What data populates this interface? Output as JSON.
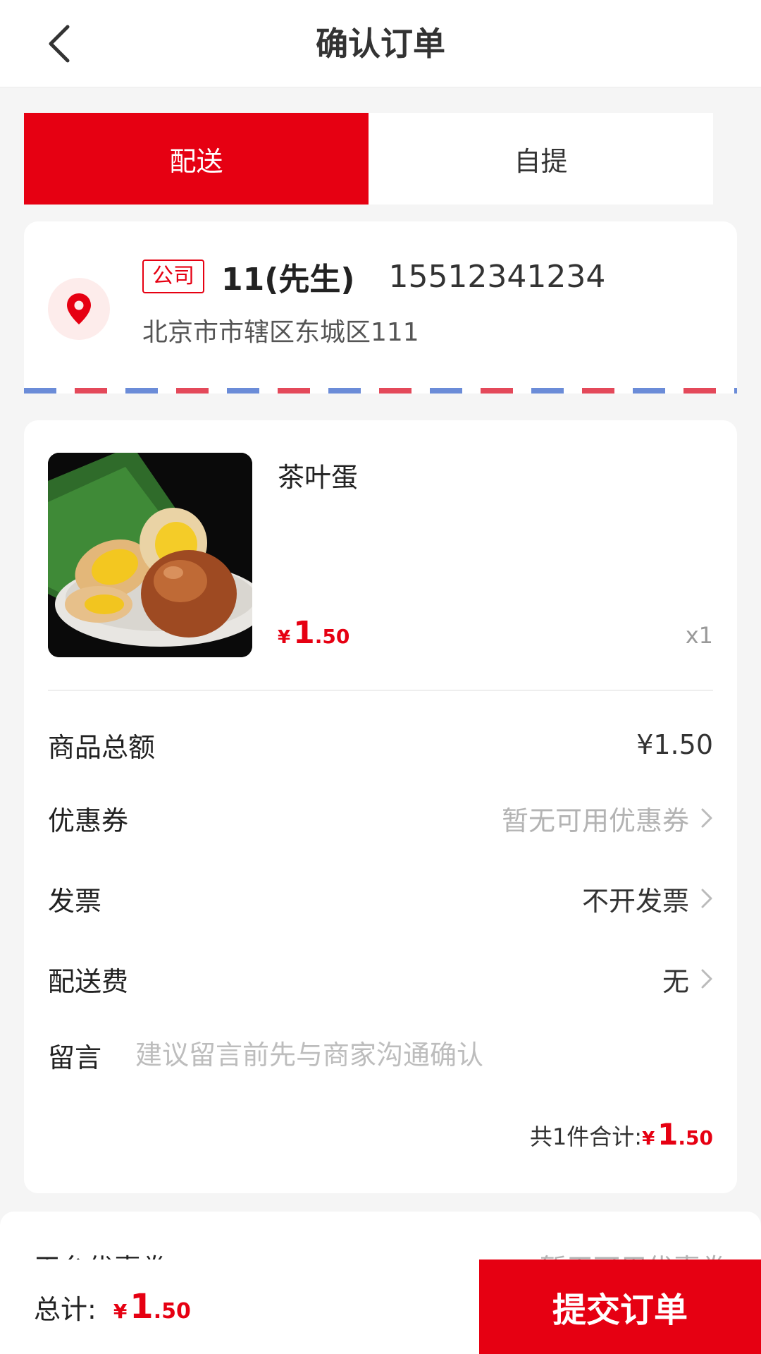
{
  "header": {
    "title": "确认订单",
    "back_icon": "chevron-left-icon"
  },
  "delivery_tabs": [
    {
      "label": "配送",
      "active": true
    },
    {
      "label": "自提",
      "active": false
    }
  ],
  "address": {
    "tag": "公司",
    "name": "11(先生)",
    "phone": "15512341234",
    "detail": "北京市市辖区东城区111",
    "icon": "location-pin-icon"
  },
  "product": {
    "name": "茶叶蛋",
    "price_symbol": "¥",
    "price_int": "1",
    "price_dec": ".50",
    "quantity": "x1",
    "image": "tea-egg-photo"
  },
  "summary": {
    "goods_total_label": "商品总额",
    "goods_total_value": "¥1.50",
    "coupon_label": "优惠券",
    "coupon_value": "暂无可用优惠券",
    "invoice_label": "发票",
    "invoice_value": "不开发票",
    "shipping_label": "配送费",
    "shipping_value": "无",
    "message_label": "留言",
    "message_placeholder": "建议留言前先与商家沟通确认",
    "message_value": "",
    "subtotal_label": "共1件合计:",
    "subtotal_symbol": "¥",
    "subtotal_int": "1",
    "subtotal_dec": ".50"
  },
  "platform_coupon": {
    "label": "平台优惠券",
    "value": "暂无可用优惠券"
  },
  "bottom_bar": {
    "total_label": "总计:",
    "total_symbol": "¥",
    "total_int": "1",
    "total_dec": ".50",
    "submit_label": "提交订单"
  },
  "colors": {
    "accent": "#e60012",
    "pin_background": "#fdeceb",
    "airmail_blue": "#6b8cd8",
    "airmail_red": "#e4495a",
    "muted_text": "#b3b3b3"
  }
}
